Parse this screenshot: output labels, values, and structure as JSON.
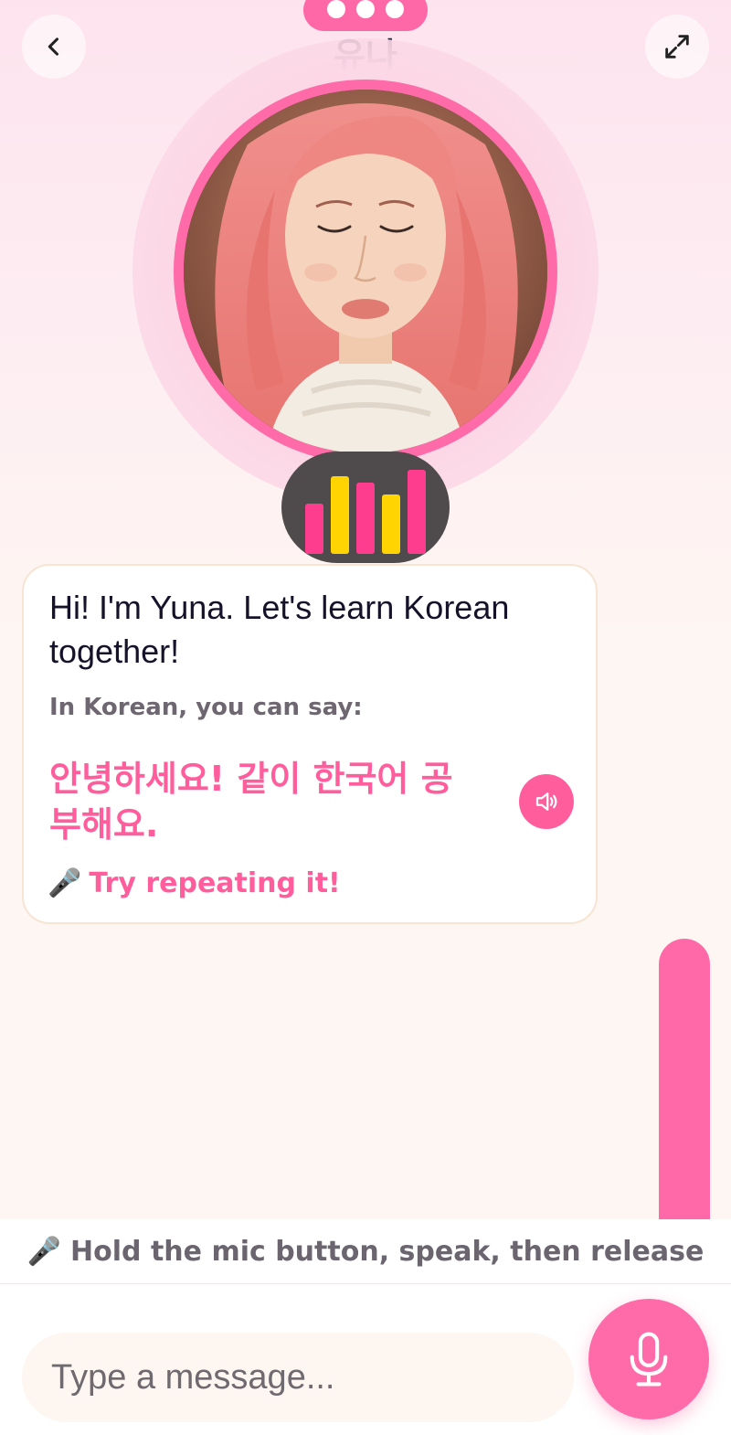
{
  "header": {
    "title": "유나",
    "back_icon": "chevron-left-icon",
    "expand_icon": "expand-icon",
    "menu_icon": "more-dots-icon"
  },
  "avatar": {
    "name": "Yuna",
    "ring_color": "#ff6ba8"
  },
  "audio_indicator": {
    "icon": "audio-bars-icon",
    "bar_levels": [
      0.55,
      0.85,
      0.78,
      0.65,
      0.92
    ],
    "bar_colors": [
      "#ff3d8f",
      "#ffd400",
      "#ff3d8f",
      "#ffd400",
      "#ff3d8f"
    ]
  },
  "message": {
    "greeting": "Hi! I'm Yuna. Let's learn Korean together!",
    "prompt": "In Korean, you can say:",
    "korean": "안녕하세요! 같이 한국어 공부해요.",
    "hint_emoji": "🎤",
    "hint": "Try repeating it!",
    "speaker_icon": "speaker-icon"
  },
  "instructions": {
    "emoji": "🎤",
    "text": "Hold the mic button, speak, then release"
  },
  "composer": {
    "placeholder": "Type a message...",
    "mic_icon": "microphone-icon"
  },
  "colors": {
    "accent": "#ff5d9c",
    "pill": "#ff68a6",
    "scroll_rail": "#ff69a8"
  }
}
